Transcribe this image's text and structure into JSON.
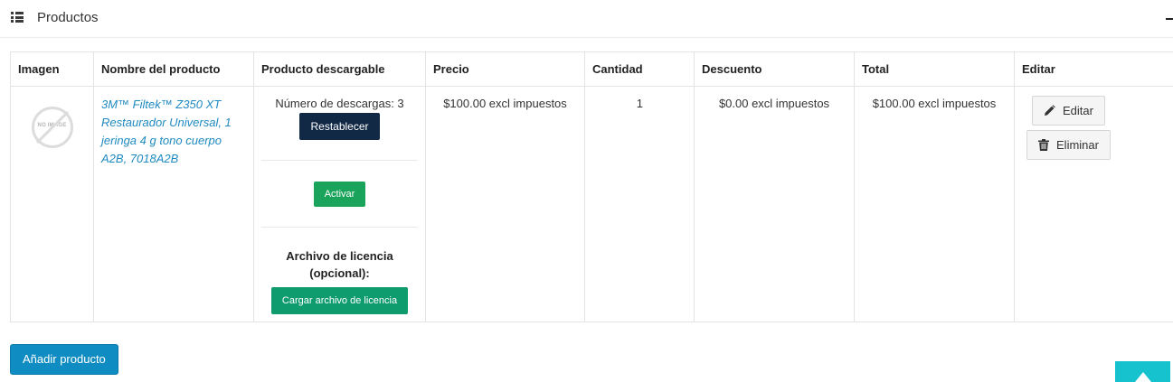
{
  "panel": {
    "title": "Productos",
    "icons": {
      "list": "list-icon",
      "collapse": "minus-icon"
    }
  },
  "table": {
    "headers": [
      "Imagen",
      "Nombre del producto",
      "Producto descargable",
      "Precio",
      "Cantidad",
      "Descuento",
      "Total",
      "Editar"
    ],
    "row": {
      "image_text": "NO IMAGE",
      "product_name": "3M™ Filtek™ Z350 XT Restaurador Universal, 1 jeringa 4 g tono cuerpo A2B, 7018A2B",
      "downloads_text": "Número de descargas: 3",
      "reset_label": "Restablecer",
      "activate_label": "Activar",
      "license_label": "Archivo de licencia (opcional):",
      "upload_license_label": "Cargar archivo de licencia",
      "price": "$100.00 excl impuestos",
      "quantity": "1",
      "discount": "$0.00 excl impuestos",
      "total": "$100.00 excl impuestos",
      "edit_label": "Editar",
      "delete_label": "Eliminar"
    }
  },
  "add_product_label": "Añadir producto",
  "colors": {
    "link": "#1f8ac2",
    "reset_button": "#122946",
    "activate_button": "#1aa35a",
    "upload_button": "#0e9b6e",
    "add_button": "#0f8cc2",
    "back_to_top": "#17c2cf"
  }
}
